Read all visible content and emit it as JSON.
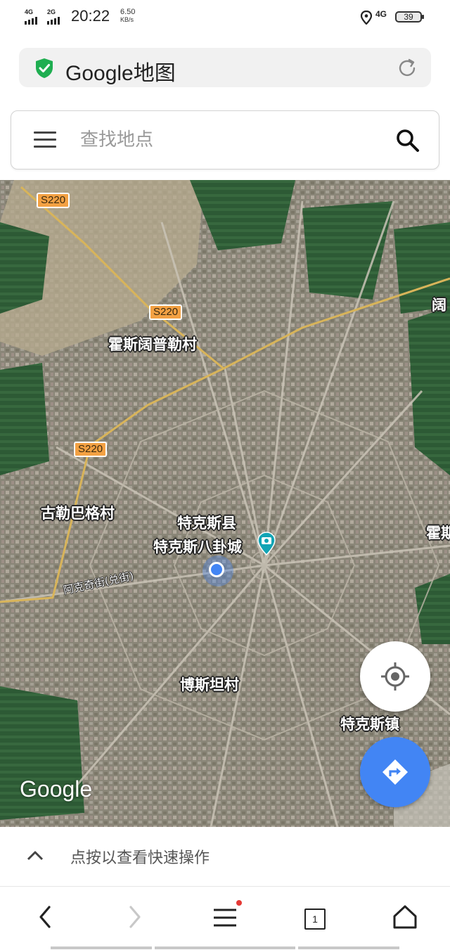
{
  "status_bar": {
    "sim1_network": "4G",
    "sim2_network": "2G",
    "time": "20:22",
    "net_speed_value": "6.50",
    "net_speed_unit": "KB/s",
    "data_network": "4G",
    "battery": "39"
  },
  "browser": {
    "title": "Google地图",
    "shield_icon": "shield-check-icon",
    "reload_icon": "reload-icon"
  },
  "search": {
    "placeholder": "查找地点",
    "value": "",
    "menu_icon": "hamburger-menu-icon",
    "search_icon": "search-icon"
  },
  "map": {
    "route_badges": [
      "S220",
      "S220",
      "S220"
    ],
    "places": [
      "霍斯阔普勒村",
      "古勒巴格村",
      "特克斯县",
      "特克斯八卦城",
      "博斯坦村",
      "特克斯镇",
      "阔",
      "霍期"
    ],
    "street": "阿克奇街(兑街)",
    "logo": "Google",
    "map_type": "satellite"
  },
  "quick_actions": {
    "label": "点按以查看快速操作"
  },
  "nav": {
    "tab_count": "1",
    "back_icon": "back-arrow-icon",
    "forward_icon": "forward-arrow-icon",
    "menu_icon": "menu-icon",
    "home_icon": "home-icon"
  },
  "colors": {
    "accent_blue": "#4285f4",
    "shield_green": "#1fae51",
    "route_badge": "#f3a143",
    "notification_dot": "#e53935"
  }
}
